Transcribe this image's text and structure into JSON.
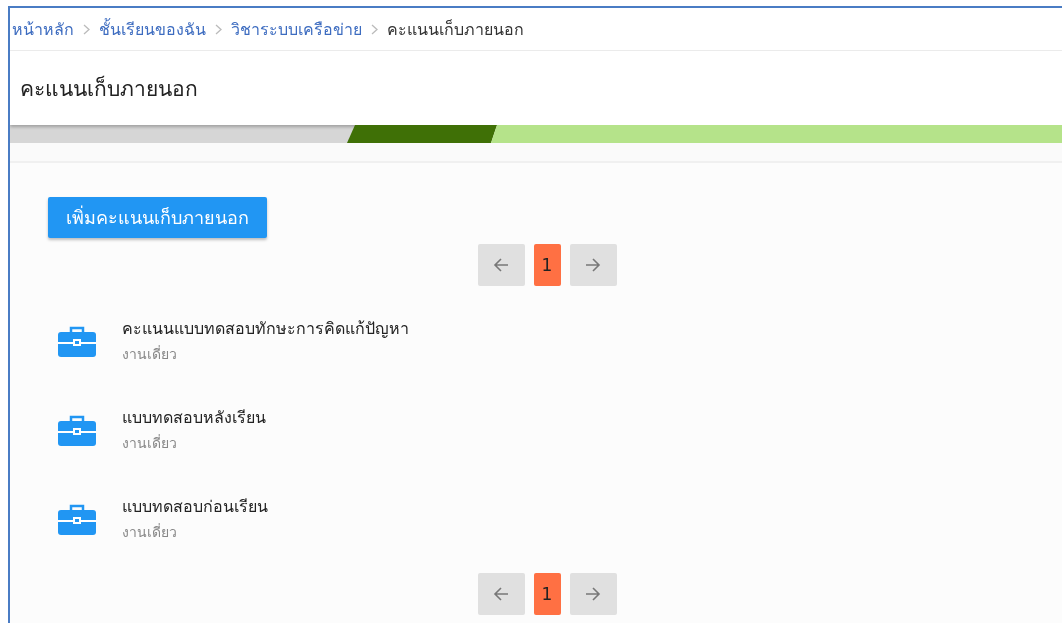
{
  "breadcrumb": [
    {
      "label": "หน้าหลัก",
      "link": true
    },
    {
      "label": "ชั้นเรียนของฉัน",
      "link": true
    },
    {
      "label": "วิชาระบบเครือข่าย",
      "link": true
    },
    {
      "label": "คะแนนเก็บภายนอก",
      "link": false
    }
  ],
  "page_title": "คะแนนเก็บภายนอก",
  "add_button": "เพิ่มคะแนนเก็บภายนอก",
  "pagination_top": {
    "pages": [
      {
        "label": "1",
        "selected": true
      }
    ]
  },
  "items": [
    {
      "title": "คะแนนแบบทดสอบทักษะการคิดแก้ปัญหา",
      "subtitle": "งานเดี่ยว"
    },
    {
      "title": "แบบทดสอบหลังเรียน",
      "subtitle": "งานเดี่ยว"
    },
    {
      "title": "แบบทดสอบก่อนเรียน",
      "subtitle": "งานเดี่ยว"
    }
  ],
  "pagination_bottom": {
    "pages": [
      {
        "label": "1",
        "selected": true
      }
    ]
  }
}
